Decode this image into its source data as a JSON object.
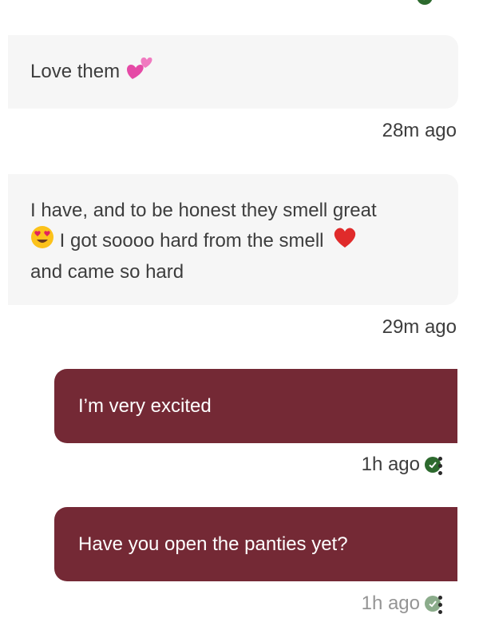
{
  "messages": [
    {
      "direction": "incoming",
      "text": "Love them",
      "emoji": "two-hearts",
      "time": "28m ago"
    },
    {
      "direction": "incoming",
      "line1": "I have, and to be honest they smell great",
      "line2": "I got soooo hard from the smell",
      "line3": "and came so hard",
      "time": "29m ago"
    },
    {
      "direction": "outgoing",
      "text": "I’m very excited",
      "time": "1h ago"
    },
    {
      "direction": "outgoing",
      "text": "Have you open the panties yet?",
      "time": "1h ago"
    }
  ],
  "colors": {
    "outgoing_bubble": "#742935",
    "incoming_bubble": "#f6f6f6",
    "read_check": "#2d6a2e"
  }
}
